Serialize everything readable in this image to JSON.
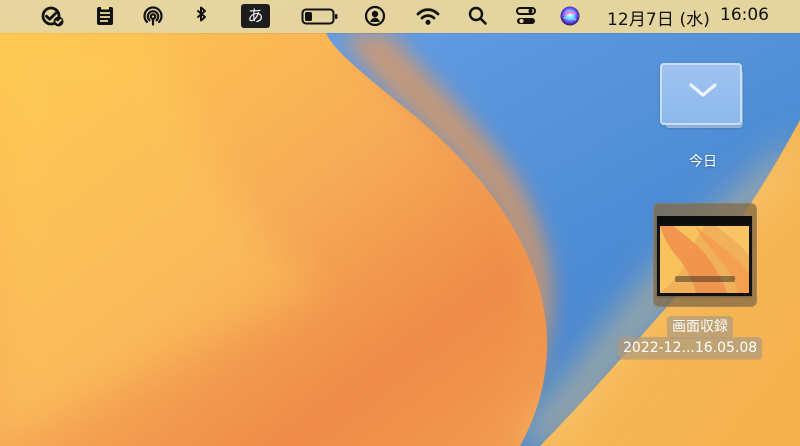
{
  "menubar": {
    "icons": {
      "check": "check-circle-badge-icon",
      "clipboard": "clipboard-icon",
      "airdrop": "airdrop-icon",
      "bluetooth": "bluetooth-icon",
      "battery": "battery-icon",
      "user": "user-icon",
      "wifi": "wifi-icon",
      "search": "search-icon",
      "control_center": "control-center-icon",
      "siri": "siri-icon"
    },
    "ime_label": "あ",
    "date": "12月7日 (水)",
    "time": "16:06",
    "battery_level": 0.28
  },
  "desktop": {
    "folder": {
      "label": "今日"
    },
    "recording_file": {
      "label_line_1": "画面収録",
      "label_line_2": "2022-12...16.05.08"
    }
  },
  "colors": {
    "menubar_bg": "#F0D998",
    "folder_blue": "#8CB8EC",
    "wallpaper_orange": "#F4A65A",
    "wallpaper_blue": "#4F8ED6"
  }
}
